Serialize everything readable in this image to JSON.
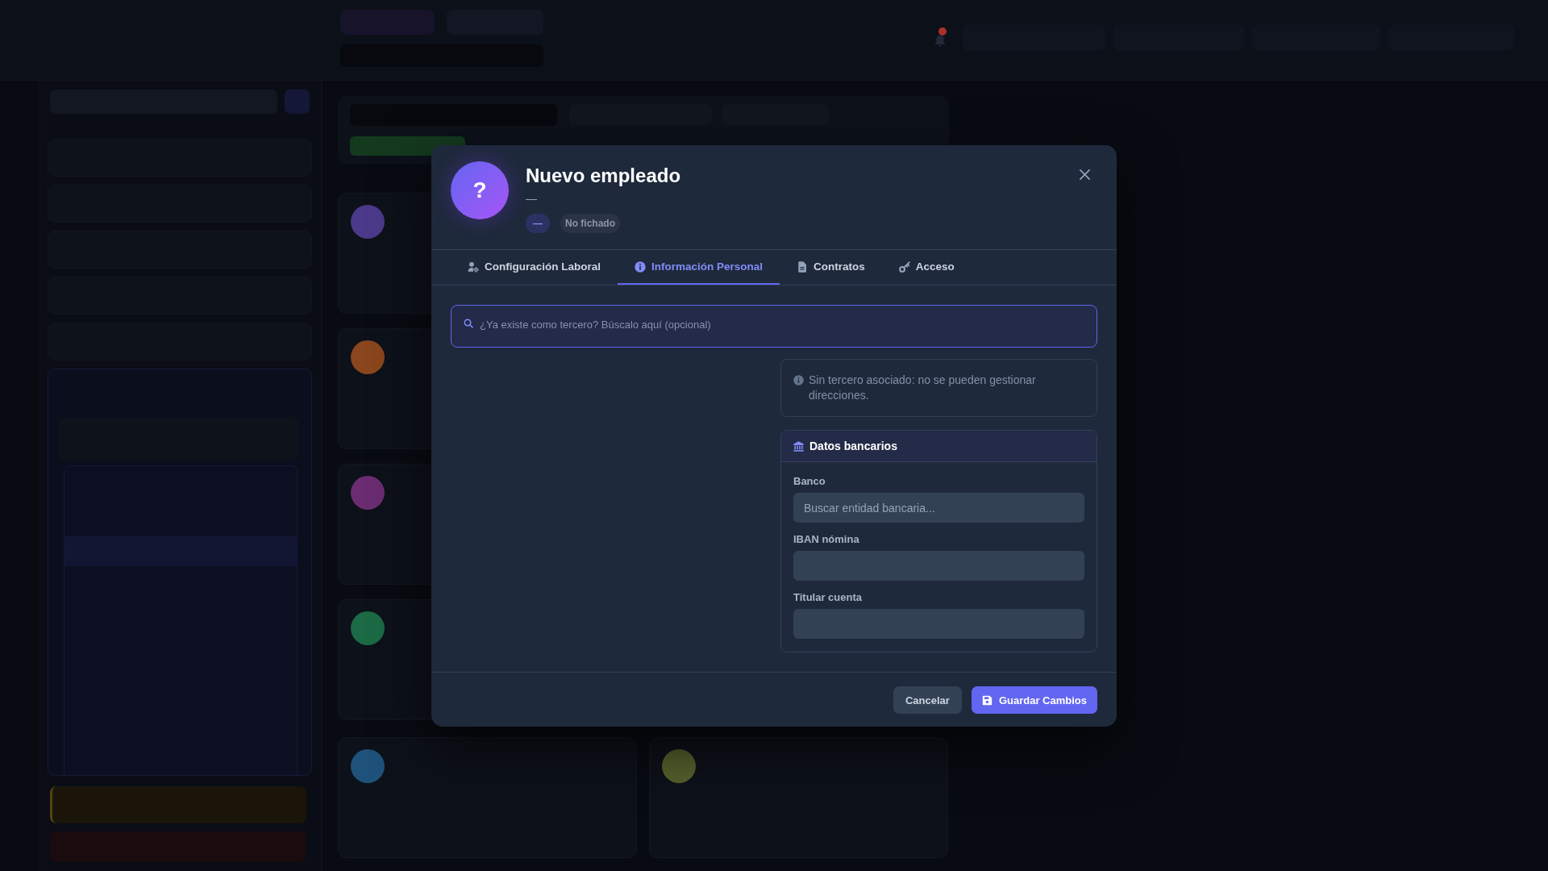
{
  "background": {
    "top_bar": {
      "unread_notifications": true
    },
    "employee_cards": [
      {
        "color": "#4b3a8a"
      },
      {
        "color": "#8a461c"
      },
      {
        "color": "#6b2c72"
      },
      {
        "color": "#1c6a46"
      },
      {
        "color": "#1e527a"
      },
      {
        "color": "#55602c"
      }
    ]
  },
  "dialog": {
    "avatar": {
      "glyph": "?"
    },
    "title": "Nuevo empleado",
    "subtitle": "—",
    "badges": [
      {
        "text": "—",
        "kind": "role"
      },
      {
        "text": "No fichado",
        "kind": "status"
      }
    ],
    "tabs": [
      {
        "label": "Configuración Laboral",
        "selected": false
      },
      {
        "label": "Información Personal",
        "selected": true
      },
      {
        "label": "Contratos",
        "selected": false
      },
      {
        "label": "Acceso",
        "selected": false
      }
    ],
    "search": {
      "placeholder": "¿Ya existe como tercero? Búscalo aquí (opcional)",
      "focused": true
    },
    "notice": "Sin tercero asociado: no se pueden gestionar direcciones.",
    "bank_panel": {
      "title": "Datos bancarios",
      "fields": [
        {
          "label": "Banco",
          "placeholder": "Buscar entidad bancaria..."
        },
        {
          "label": "IBAN nómina"
        },
        {
          "label": "Titular cuenta"
        }
      ]
    },
    "buttons": [
      {
        "label": "Cancelar",
        "kind": "secondary"
      },
      {
        "label": "Guardar Cambios",
        "kind": "primary"
      }
    ]
  }
}
